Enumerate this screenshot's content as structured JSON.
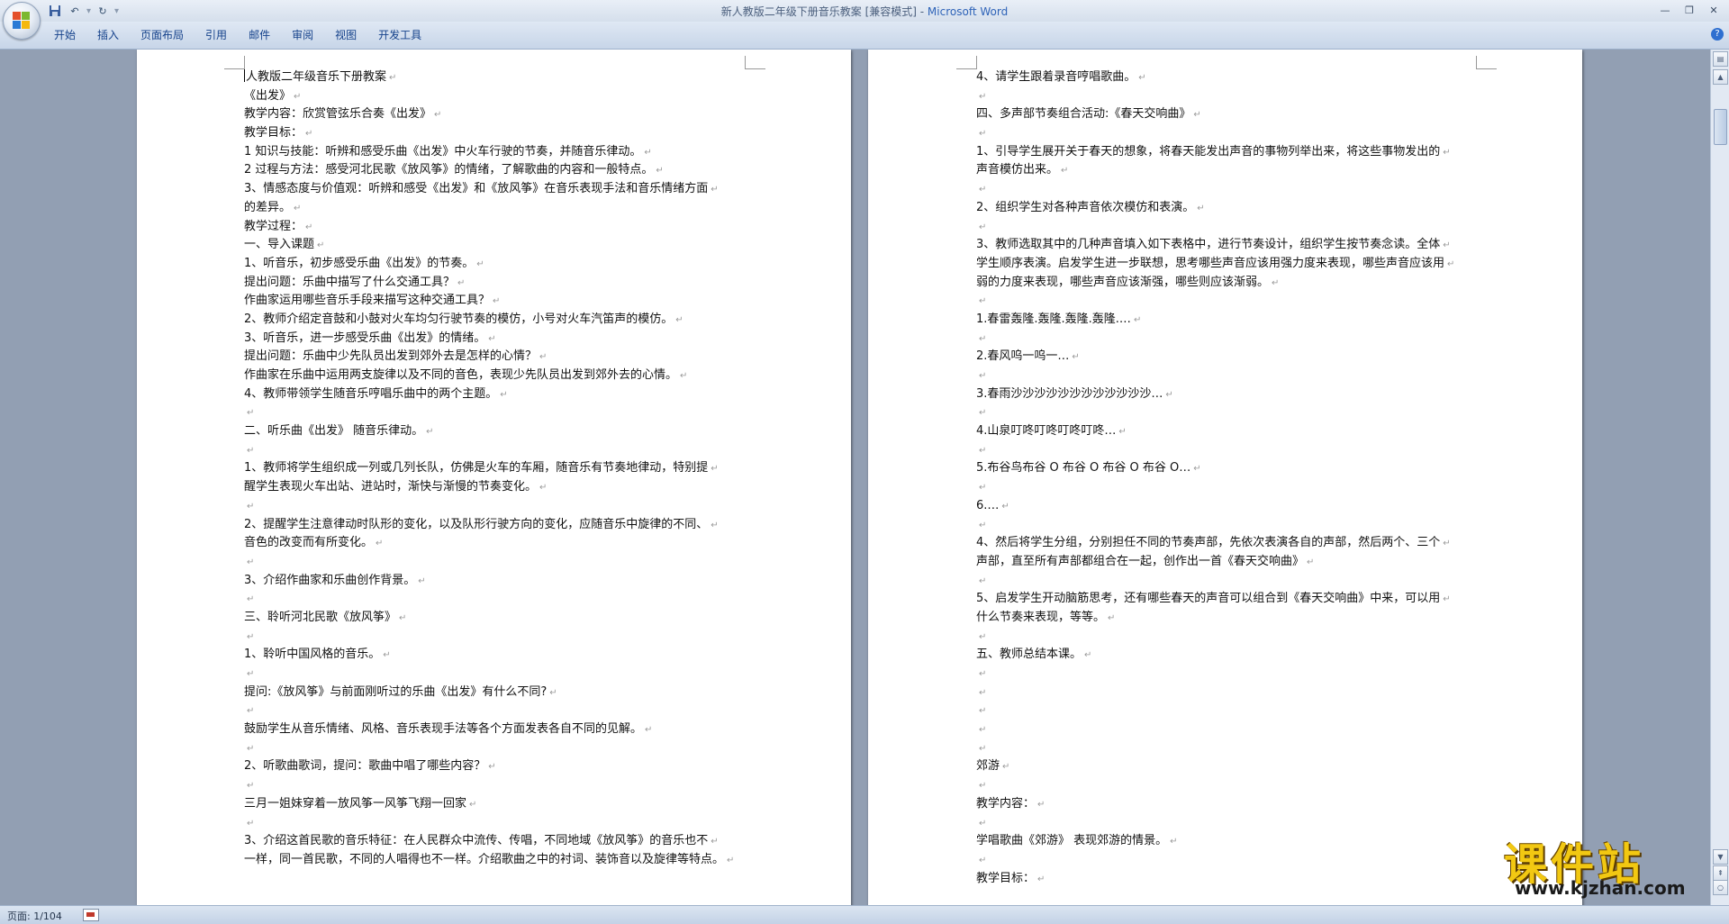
{
  "window": {
    "title": "新人教版二年级下册音乐教案 [兼容模式] - ",
    "app_name": "Microsoft Word"
  },
  "quick_access": {
    "save_icon": "save-icon",
    "undo_icon": "undo-icon",
    "redo_icon": "redo-icon"
  },
  "ribbon": {
    "tabs": [
      "开始",
      "插入",
      "页面布局",
      "引用",
      "邮件",
      "审阅",
      "视图",
      "开发工具"
    ]
  },
  "status": {
    "page": "页面: 1/104"
  },
  "watermark": {
    "text": "课件站",
    "url": "www.kjzhan.com"
  },
  "page1": {
    "lines": [
      "人教版二年级音乐下册教案",
      "《出发》",
      "教学内容：欣赏管弦乐合奏《出发》",
      "教学目标：",
      "1 知识与技能：听辨和感受乐曲《出发》中火车行驶的节奏，并随音乐律动。",
      "2 过程与方法：感受河北民歌《放风筝》的情绪，了解歌曲的内容和一般特点。",
      "3、情感态度与价值观：听辨和感受《出发》和《放风筝》在音乐表现手法和音乐情绪方面",
      "的差异。",
      "教学过程：",
      "一、导入课题",
      "1、听音乐，初步感受乐曲《出发》的节奏。",
      "提出问题：乐曲中描写了什么交通工具？",
      "作曲家运用哪些音乐手段来描写这种交通工具？",
      "2、教师介绍定音鼓和小鼓对火车均匀行驶节奏的模仿，小号对火车汽笛声的模仿。",
      "3、听音乐，进一步感受乐曲《出发》的情绪。",
      "提出问题：乐曲中少先队员出发到郊外去是怎样的心情？",
      "作曲家在乐曲中运用两支旋律以及不同的音色，表现少先队员出发到郊外去的心情。",
      "4、教师带领学生随音乐哼唱乐曲中的两个主题。",
      "",
      "二、听乐曲《出发》 随音乐律动。",
      "",
      "1、教师将学生组织成一列或几列长队，仿佛是火车的车厢，随音乐有节奏地律动，特别提",
      "醒学生表现火车出站、进站时，渐快与渐慢的节奏变化。",
      "",
      "2、提醒学生注意律动时队形的变化，以及队形行驶方向的变化，应随音乐中旋律的不同、",
      "音色的改变而有所变化。",
      "",
      "3、介绍作曲家和乐曲创作背景。",
      "",
      "三、聆听河北民歌《放风筝》",
      "",
      "1、聆听中国风格的音乐。",
      "",
      "提问:《放风筝》与前面刚听过的乐曲《出发》有什么不同?",
      "",
      "鼓励学生从音乐情绪、风格、音乐表现手法等各个方面发表各自不同的见解。",
      "",
      "2、听歌曲歌词，提问：歌曲中唱了哪些内容？",
      "",
      "三月一姐妹穿着一放风筝一风筝飞翔一回家",
      "",
      "3、介绍这首民歌的音乐特征：在人民群众中流传、传唱，不同地域《放风筝》的音乐也不",
      "一样，同一首民歌，不同的人唱得也不一样。介绍歌曲之中的衬词、装饰音以及旋律等特点。"
    ]
  },
  "page2": {
    "lines": [
      "4、请学生跟着录音哼唱歌曲。",
      "",
      "四、多声部节奏组合活动:《春天交响曲》",
      "",
      "1、引导学生展开关于春天的想象，将春天能发出声音的事物列举出来，将这些事物发出的",
      "声音模仿出来。",
      "",
      "2、组织学生对各种声音依次模仿和表演。",
      "",
      "3、教师选取其中的几种声音填入如下表格中，进行节奏设计，组织学生按节奏念读。全体",
      "学生顺序表演。启发学生进一步联想，思考哪些声音应该用强力度来表现，哪些声音应该用",
      "弱的力度来表现，哪些声音应该渐强，哪些则应该渐弱。",
      "",
      "1.春雷轰隆.轰隆.轰隆.轰隆.…",
      "",
      "2.春风呜一呜一…",
      "",
      "3.春雨沙沙沙沙沙沙沙沙沙沙沙沙…",
      "",
      "4.山泉叮咚叮咚叮咚叮咚…",
      "",
      "5.布谷鸟布谷 O 布谷 O 布谷 O 布谷 O…",
      "",
      "6.…",
      "",
      "4、然后将学生分组，分别担任不同的节奏声部，先依次表演各自的声部，然后两个、三个",
      "声部，直至所有声部都组合在一起，创作出一首《春天交响曲》",
      "",
      "5、启发学生开动脑筋思考，还有哪些春天的声音可以组合到《春天交响曲》中来，可以用",
      "什么节奏来表现，等等。",
      "",
      "五、教师总结本课。",
      "",
      " ",
      "",
      "",
      "",
      "郊游",
      "",
      "教学内容：",
      "",
      "学唱歌曲《郊游》 表现郊游的情景。",
      "",
      "教学目标："
    ]
  }
}
